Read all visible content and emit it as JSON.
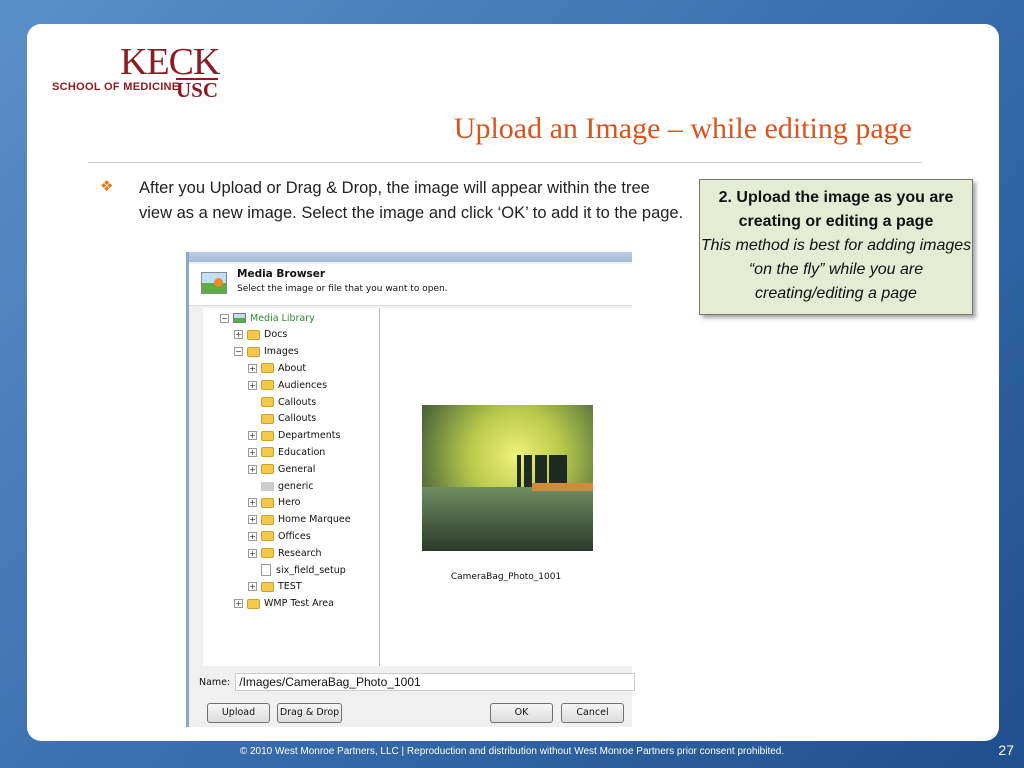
{
  "logo": {
    "line1": "KECK",
    "line2": "SCHOOL OF MEDICINE",
    "line3": "USC"
  },
  "slide": {
    "title": "Upload an Image – while editing page",
    "bullet": "After you Upload or Drag & Drop, the image will appear within the tree view as a new image. Select the image and click ‘OK’ to add it to the page.",
    "callout_bold": "2. Upload the image as you are creating or editing a page",
    "callout_italic": "This method is best for adding images “on the fly” while you are creating/editing a page",
    "page_number": "27",
    "footer": "© 2010 West Monroe Partners, LLC  |  Reproduction and distribution without West Monroe Partners prior consent prohibited."
  },
  "dialog": {
    "title": "Media Browser",
    "subtitle": "Select the image or file that you want to open.",
    "tree": [
      {
        "label": "Media Library",
        "level": 0,
        "expander": "minus",
        "icon": "library"
      },
      {
        "label": "Docs",
        "level": 1,
        "expander": "plus",
        "icon": "folder"
      },
      {
        "label": "Images",
        "level": 1,
        "expander": "minus",
        "icon": "folder"
      },
      {
        "label": "About",
        "level": 2,
        "expander": "plus",
        "icon": "folder"
      },
      {
        "label": "Audiences",
        "level": 2,
        "expander": "plus",
        "icon": "folder"
      },
      {
        "label": "Callouts",
        "level": 2,
        "expander": "none",
        "icon": "folder"
      },
      {
        "label": "Callouts",
        "level": 2,
        "expander": "none",
        "icon": "folder"
      },
      {
        "label": "Departments",
        "level": 2,
        "expander": "plus",
        "icon": "folder"
      },
      {
        "label": "Education",
        "level": 2,
        "expander": "plus",
        "icon": "folder"
      },
      {
        "label": "General",
        "level": 2,
        "expander": "plus",
        "icon": "folder"
      },
      {
        "label": "generic",
        "level": 2,
        "expander": "none",
        "icon": "generic"
      },
      {
        "label": "Hero",
        "level": 2,
        "expander": "plus",
        "icon": "folder"
      },
      {
        "label": "Home Marquee",
        "level": 2,
        "expander": "plus",
        "icon": "folder"
      },
      {
        "label": "Offices",
        "level": 2,
        "expander": "plus",
        "icon": "folder"
      },
      {
        "label": "Research",
        "level": 2,
        "expander": "plus",
        "icon": "folder"
      },
      {
        "label": "six_field_setup",
        "level": 2,
        "expander": "none",
        "icon": "file"
      },
      {
        "label": "TEST",
        "level": 2,
        "expander": "plus",
        "icon": "folder"
      },
      {
        "label": "WMP Test Area",
        "level": 1,
        "expander": "plus",
        "icon": "folder"
      }
    ],
    "preview_caption": "CameraBag_Photo_1001",
    "name_label": "Name:",
    "name_value": "/Images/CameraBag_Photo_1001",
    "buttons": {
      "upload": "Upload",
      "dragdrop": "Drag & Drop",
      "ok": "OK",
      "cancel": "Cancel"
    }
  }
}
